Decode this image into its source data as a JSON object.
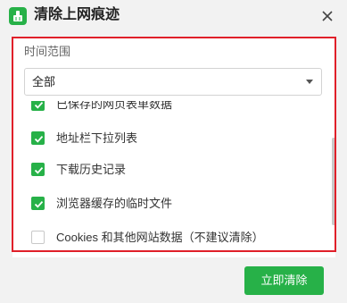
{
  "window": {
    "title": "清除上网痕迹",
    "app_icon": "broom-icon",
    "close_icon": "close-icon"
  },
  "time_range": {
    "label": "时间范围",
    "selected": "全部"
  },
  "items": [
    {
      "label": "已保存的网页表单数据",
      "checked": true
    },
    {
      "label": "地址栏下拉列表",
      "checked": true
    },
    {
      "label": "下载历史记录",
      "checked": true
    },
    {
      "label": "浏览器缓存的临时文件",
      "checked": true
    },
    {
      "label": "Cookies 和其他网站数据（不建议清除）",
      "checked": false
    }
  ],
  "actions": {
    "clear_label": "立即清除"
  },
  "colors": {
    "accent": "#27b148",
    "highlight": "#e0202a"
  }
}
